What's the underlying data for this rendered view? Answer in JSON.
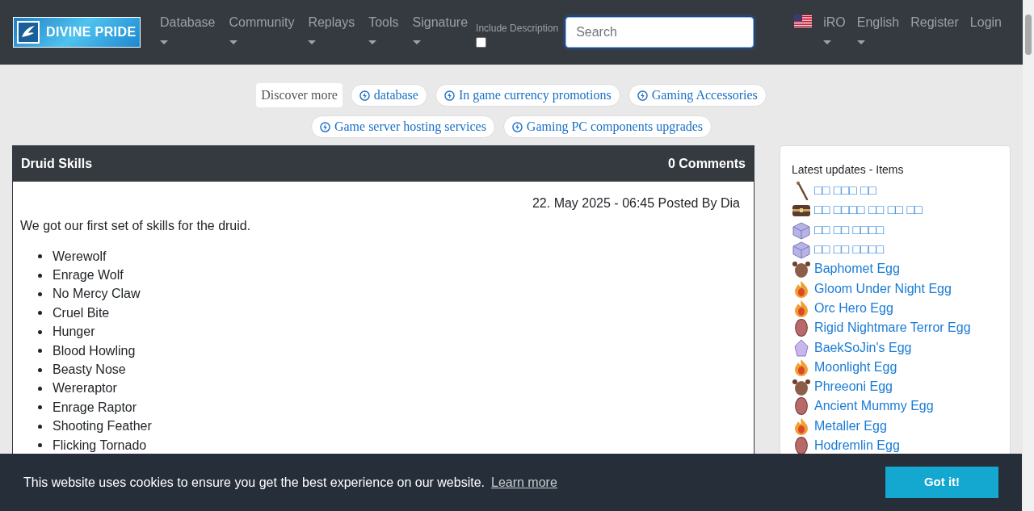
{
  "navbar": {
    "logo": "DIVINE PRIDE",
    "menu": [
      {
        "label": "Database",
        "dropdown": true
      },
      {
        "label": "Community",
        "dropdown": true
      },
      {
        "label": "Replays",
        "dropdown": true
      },
      {
        "label": "Tools",
        "dropdown": true
      },
      {
        "label": "Signature",
        "dropdown": true
      }
    ],
    "include_description": {
      "label": "Include Description",
      "checked": false
    },
    "search": {
      "placeholder": "Search"
    },
    "right": [
      {
        "label": "iRO",
        "dropdown": true
      },
      {
        "label": "English",
        "dropdown": true
      },
      {
        "label": "Register",
        "dropdown": false
      },
      {
        "label": "Login",
        "dropdown": false
      }
    ]
  },
  "discover": {
    "label": "Discover more",
    "chips": [
      "database",
      "In game currency promotions",
      "Gaming Accessories",
      "Game server hosting services",
      "Gaming PC components upgrades"
    ]
  },
  "article": {
    "title": "Druid Skills",
    "comments": "0 Comments",
    "meta": "22. May 2025 - 06:45 Posted By Dia",
    "intro": "We got our first set of skills for the druid.",
    "skills": [
      "Werewolf",
      "Enrage Wolf",
      "No Mercy Claw",
      "Cruel Bite",
      "Hunger",
      "Blood Howling",
      "Beasty Nose",
      "Wereraptor",
      "Enrage Raptor",
      "Shooting Feather",
      "Flicking Tornado"
    ]
  },
  "sidebar": {
    "title": "Latest updates - Items",
    "items": [
      {
        "name": "□□ □□□ □□",
        "kind": "staff"
      },
      {
        "name": "□□ □□□□ □□ □□ □□",
        "kind": "chest"
      },
      {
        "name": "□□ □□ □□□□",
        "kind": "box"
      },
      {
        "name": "□□ □□ □□□□",
        "kind": "box"
      },
      {
        "name": "Baphomet Egg",
        "kind": "creature"
      },
      {
        "name": "Gloom Under Night Egg",
        "kind": "flame"
      },
      {
        "name": "Orc Hero Egg",
        "kind": "flame"
      },
      {
        "name": "Rigid Nightmare Terror Egg",
        "kind": "egg"
      },
      {
        "name": "BaekSoJin's Egg",
        "kind": "crystal"
      },
      {
        "name": "Moonlight Egg",
        "kind": "flame"
      },
      {
        "name": "Phreeoni Egg",
        "kind": "creature"
      },
      {
        "name": "Ancient Mummy Egg",
        "kind": "egg"
      },
      {
        "name": "Metaller Egg",
        "kind": "flame"
      },
      {
        "name": "Hodremlin Egg",
        "kind": "egg"
      }
    ]
  },
  "cookie": {
    "text": "This website uses cookies to ensure you get the best experience on our website.",
    "link": "Learn more",
    "button": "Got it!"
  }
}
